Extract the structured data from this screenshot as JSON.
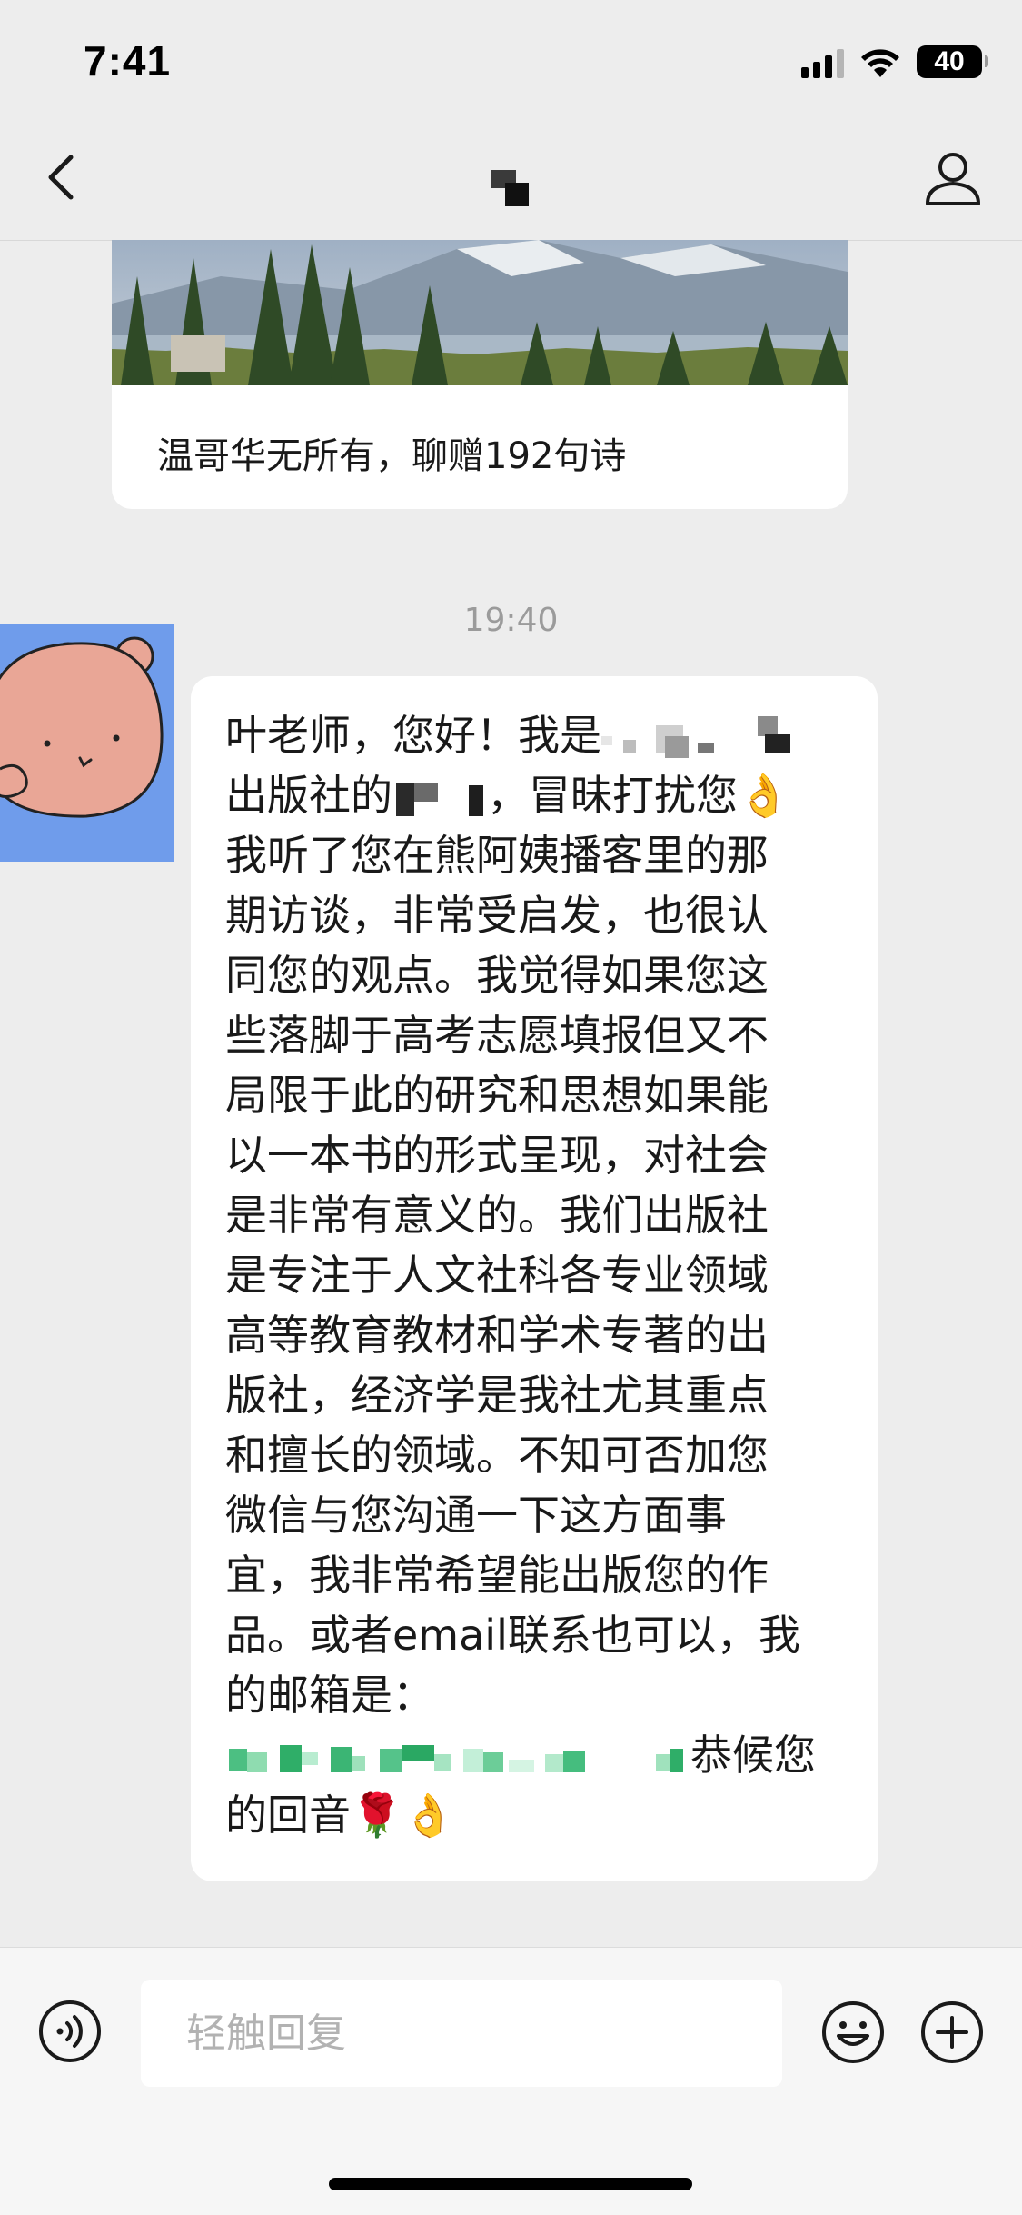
{
  "status_bar": {
    "time": "7:41",
    "battery": "40",
    "icons": [
      "signal-icon",
      "wifi-icon",
      "battery-icon"
    ]
  },
  "nav": {
    "back_icon": "chevron-left-icon",
    "profile_icon": "person-icon"
  },
  "article": {
    "title": "温哥华无所有，聊赠192句诗"
  },
  "timestamp": "19:40",
  "message": {
    "segments": [
      "叶老师，您好！我是",
      "出版社的",
      "，冒昧打扰您👌",
      "我听了您在熊阿姨播客里的那",
      "期访谈，非常受启发，也很认",
      "同您的观点。我觉得如果您这",
      "些落脚于高考志愿填报但又不",
      "局限于此的研究和思想如果能",
      "以一本书的形式呈现，对社会",
      "是非常有意义的。我们出版社",
      "是专注于人文社科各专业领域",
      "高等教育教材和学术专著的出",
      "版社，经济学是我社尤其重点",
      "和擅长的领域。不知可否加您",
      "微信与您沟通一下这方面事",
      "宜，我非常希望能出版您的作",
      "品。或者email联系也可以，我",
      "的邮箱是：",
      "恭候您",
      "的回音🌹👌"
    ]
  },
  "input": {
    "placeholder": "轻触回复"
  },
  "bottom_icons": {
    "voice": "voice-icon",
    "emoji": "smiley-icon",
    "plus": "plus-circle-icon"
  },
  "colors": {
    "background": "#ededed",
    "bubble": "#ffffff",
    "avatar_bg": "#6f9ceb"
  }
}
